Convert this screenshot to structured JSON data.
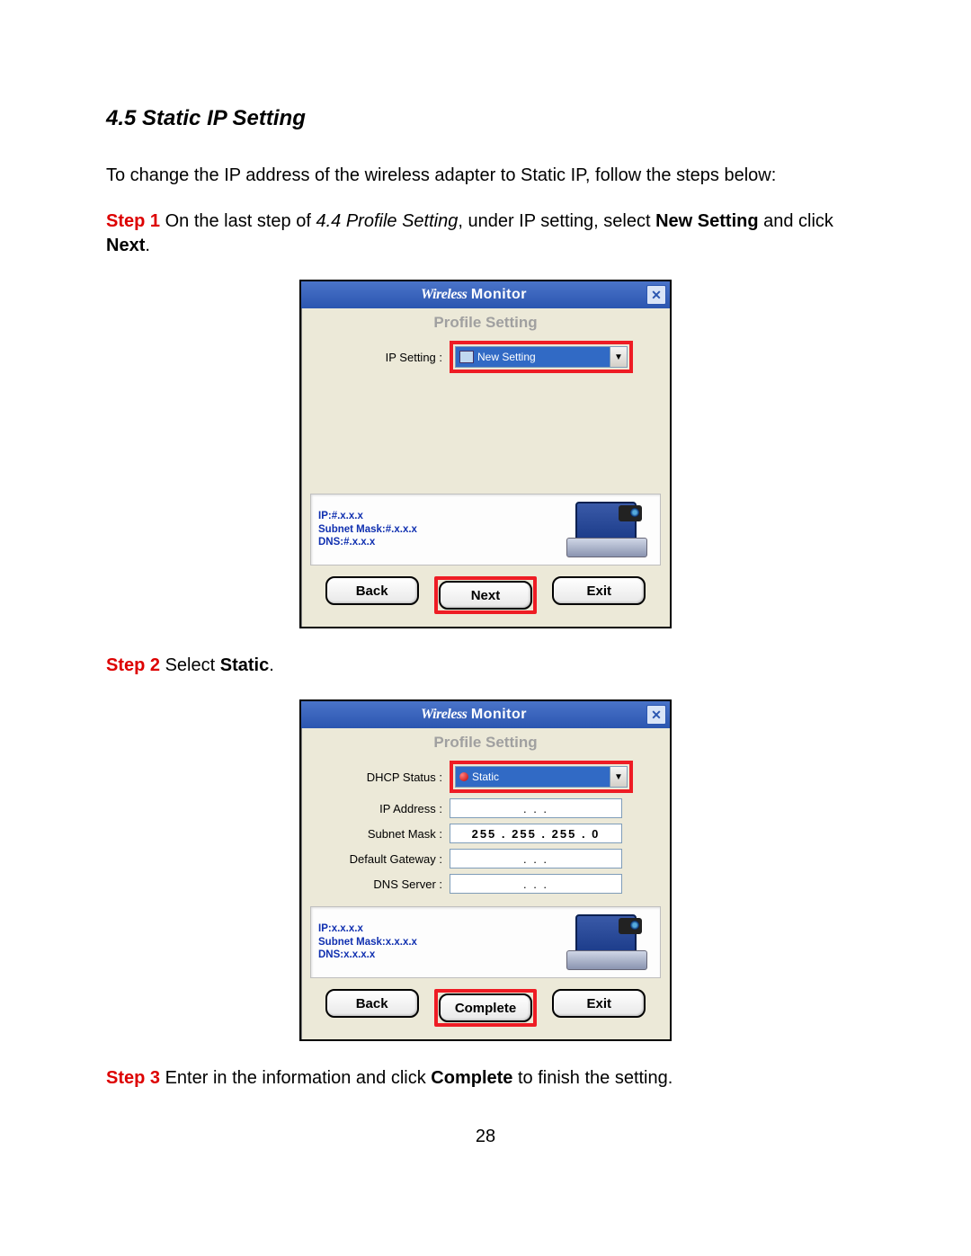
{
  "section": {
    "number": "4.5",
    "title": "Static IP Setting"
  },
  "intro": "To change the IP address of the wireless adapter to Static IP, follow the steps below:",
  "steps": {
    "s1": {
      "label": "Step 1",
      "t1": " On the last step of ",
      "t2_italic": "4.4 Profile Setting",
      "t3": ", under IP setting, select ",
      "t4_bold": "New Setting",
      "t5": " and click ",
      "t6_bold": "Next",
      "t7": "."
    },
    "s2": {
      "label": "Step 2",
      "t1": " Select ",
      "t2_bold": "Static",
      "t3": "."
    },
    "s3": {
      "label": "Step 3",
      "t1": " Enter in the information and click ",
      "t2_bold": "Complete",
      "t3": " to finish the setting."
    }
  },
  "dialog1": {
    "title_italic": "Wireless",
    "title_bold": "Monitor",
    "panel_title": "Profile Setting",
    "ip_setting_label": "IP Setting :",
    "ip_setting_value": "New Setting",
    "info": {
      "l1": "IP:#.x.x.x",
      "l2": "Subnet Mask:#.x.x.x",
      "l3": "DNS:#.x.x.x"
    },
    "buttons": {
      "back": "Back",
      "next": "Next",
      "exit": "Exit"
    }
  },
  "dialog2": {
    "title_italic": "Wireless",
    "title_bold": "Monitor",
    "panel_title": "Profile Setting",
    "labels": {
      "dhcp": "DHCP Status :",
      "ip": "IP Address :",
      "subnet": "Subnet Mask :",
      "gateway": "Default Gateway :",
      "dns": "DNS Server :"
    },
    "values": {
      "dhcp": "Static",
      "ip": ".       .       .",
      "subnet": "255 . 255 . 255 .   0",
      "gateway": ".       .       .",
      "dns": ".       .       ."
    },
    "info": {
      "l1": "IP:x.x.x.x",
      "l2": "Subnet Mask:x.x.x.x",
      "l3": "DNS:x.x.x.x"
    },
    "buttons": {
      "back": "Back",
      "complete": "Complete",
      "exit": "Exit"
    }
  },
  "page_number": "28"
}
